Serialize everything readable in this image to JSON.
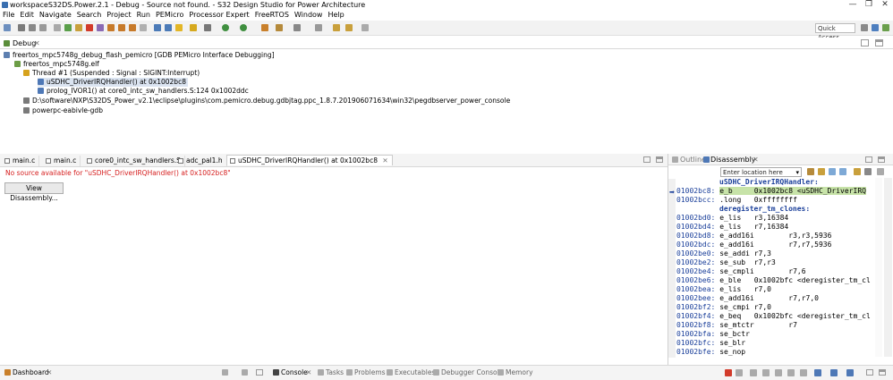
{
  "window": {
    "title": "workspaceS32DS.Power.2.1 - Debug - Source not found. - S32 Design Studio for Power Architecture",
    "min": "—",
    "max": "❐",
    "close": "✕"
  },
  "menu": [
    "File",
    "Edit",
    "Navigate",
    "Search",
    "Project",
    "Run",
    "PEMicro",
    "Processor Expert",
    "FreeRTOS",
    "Window",
    "Help"
  ],
  "toolbar": {
    "quick_access": "Quick Access"
  },
  "debug": {
    "tab": "Debug",
    "close": "✕",
    "launch": "freertos_mpc5748g_debug_flash_pemicro [GDB PEMicro Interface Debugging]",
    "elf": "freertos_mpc5748g.elf",
    "thread": "Thread #1 (Suspended : Signal : SIGINT:Interrupt)",
    "frame1": "uSDHC_DriverIRQHandler() at 0x1002bc8",
    "frame2": "prolog_IVOR1() at core0_intc_sw_handlers.S:124 0x1002ddc",
    "server": "D:\\software\\NXP\\S32DS_Power_v2.1\\eclipse\\plugins\\com.pemicro.debug.gdbjtag.ppc_1.8.7.201906071634\\win32\\pegdbserver_power_console",
    "gdb": "powerpc-eabivle-gdb"
  },
  "editor": {
    "tabs": [
      "main.c",
      "main.c",
      "core0_intc_sw_handlers.S",
      "adc_pal1.h",
      "uSDHC_DriverIRQHandler() at 0x1002bc8"
    ],
    "active_close": "✕",
    "message": "No source available for \"uSDHC_DriverIRQHandler() at 0x1002bc8\"",
    "button": "View Disassembly..."
  },
  "right": {
    "outline_tab": "Outline",
    "disasm_tab": "Disassembly",
    "close": "✕",
    "location_placeholder": "Enter location here",
    "dropdown": "▾"
  },
  "disasm": [
    {
      "kind": "label",
      "text": "uSDHC_DriverIRQHandler:"
    },
    {
      "kind": "inst",
      "addr": "01002bc8:",
      "text": "e_b     0x1002bc8 <uSDHC_DriverIRQ",
      "hl": true
    },
    {
      "kind": "inst",
      "addr": "01002bcc:",
      "text": ".long   0xffffffff"
    },
    {
      "kind": "label",
      "text": "deregister_tm_clones:"
    },
    {
      "kind": "inst",
      "addr": "01002bd0:",
      "text": "e_lis   r3,16384"
    },
    {
      "kind": "inst",
      "addr": "01002bd4:",
      "text": "e_lis   r7,16384"
    },
    {
      "kind": "inst",
      "addr": "01002bd8:",
      "text": "e_add16i        r3,r3,5936"
    },
    {
      "kind": "inst",
      "addr": "01002bdc:",
      "text": "e_add16i        r7,r7,5936"
    },
    {
      "kind": "inst",
      "addr": "01002be0:",
      "text": "se_addi r7,3"
    },
    {
      "kind": "inst",
      "addr": "01002be2:",
      "text": "se_sub  r7,r3"
    },
    {
      "kind": "inst",
      "addr": "01002be4:",
      "text": "se_cmpli        r7,6"
    },
    {
      "kind": "inst",
      "addr": "01002be6:",
      "text": "e_ble   0x1002bfc <deregister_tm_cl"
    },
    {
      "kind": "inst",
      "addr": "01002bea:",
      "text": "e_lis   r7,0"
    },
    {
      "kind": "inst",
      "addr": "01002bee:",
      "text": "e_add16i        r7,r7,0"
    },
    {
      "kind": "inst",
      "addr": "01002bf2:",
      "text": "se_cmpi r7,0"
    },
    {
      "kind": "inst",
      "addr": "01002bf4:",
      "text": "e_beq   0x1002bfc <deregister_tm_cl"
    },
    {
      "kind": "inst",
      "addr": "01002bf8:",
      "text": "se_mtctr        r7"
    },
    {
      "kind": "inst",
      "addr": "01002bfa:",
      "text": "se_bctr"
    },
    {
      "kind": "inst",
      "addr": "01002bfc:",
      "text": "se_blr"
    },
    {
      "kind": "inst",
      "addr": "01002bfe:",
      "text": "se_nop"
    }
  ],
  "bottom": {
    "dashboard": "Dashboard",
    "console": "Console",
    "tasks": "Tasks",
    "problems": "Problems",
    "executables": "Executables",
    "debugger_console": "Debugger Console",
    "memory": "Memory"
  }
}
